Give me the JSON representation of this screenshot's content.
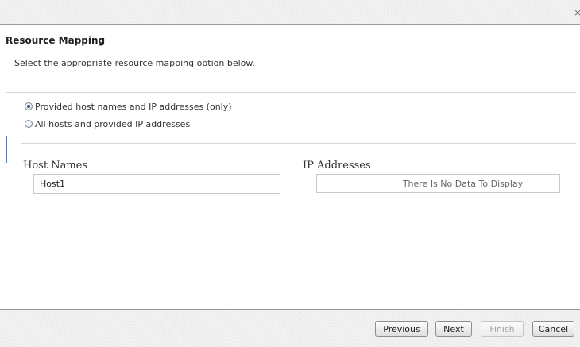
{
  "dialog": {
    "close_glyph": "×"
  },
  "section": {
    "title": "Resource Mapping",
    "description": "Select the appropriate resource mapping option below."
  },
  "options": [
    {
      "label": "Provided host names and IP addresses (only)",
      "checked": true
    },
    {
      "label": "All hosts and provided IP addresses",
      "checked": false
    }
  ],
  "host_names": {
    "label": "Host Names",
    "items": [
      "Host1"
    ]
  },
  "ip_addresses": {
    "label": "IP Addresses",
    "empty_text": "There Is No Data To Display"
  },
  "buttons": {
    "previous": "Previous",
    "next": "Next",
    "finish": "Finish",
    "cancel": "Cancel",
    "finish_enabled": false
  },
  "colors": {
    "radio_selected": "#1d4f86",
    "divider": "#d5d5d5",
    "accent_bar": "#5a7fb0"
  }
}
